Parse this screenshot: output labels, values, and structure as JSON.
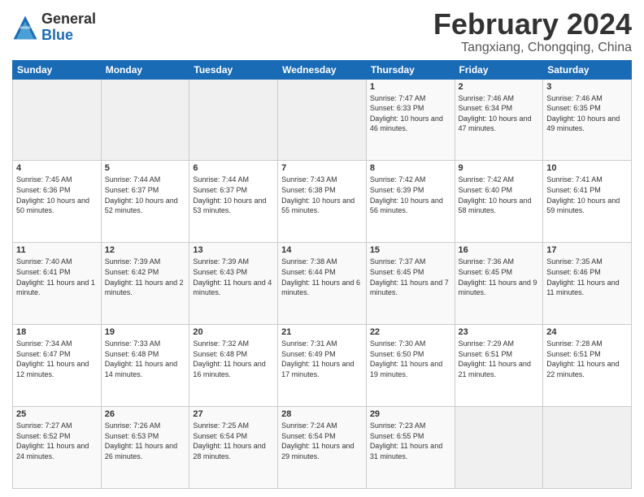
{
  "logo": {
    "general": "General",
    "blue": "Blue"
  },
  "title": {
    "month_year": "February 2024",
    "location": "Tangxiang, Chongqing, China"
  },
  "weekdays": [
    "Sunday",
    "Monday",
    "Tuesday",
    "Wednesday",
    "Thursday",
    "Friday",
    "Saturday"
  ],
  "weeks": [
    [
      {
        "day": "",
        "sunrise": "",
        "sunset": "",
        "daylight": ""
      },
      {
        "day": "",
        "sunrise": "",
        "sunset": "",
        "daylight": ""
      },
      {
        "day": "",
        "sunrise": "",
        "sunset": "",
        "daylight": ""
      },
      {
        "day": "",
        "sunrise": "",
        "sunset": "",
        "daylight": ""
      },
      {
        "day": "1",
        "sunrise": "Sunrise: 7:47 AM",
        "sunset": "Sunset: 6:33 PM",
        "daylight": "Daylight: 10 hours and 46 minutes."
      },
      {
        "day": "2",
        "sunrise": "Sunrise: 7:46 AM",
        "sunset": "Sunset: 6:34 PM",
        "daylight": "Daylight: 10 hours and 47 minutes."
      },
      {
        "day": "3",
        "sunrise": "Sunrise: 7:46 AM",
        "sunset": "Sunset: 6:35 PM",
        "daylight": "Daylight: 10 hours and 49 minutes."
      }
    ],
    [
      {
        "day": "4",
        "sunrise": "Sunrise: 7:45 AM",
        "sunset": "Sunset: 6:36 PM",
        "daylight": "Daylight: 10 hours and 50 minutes."
      },
      {
        "day": "5",
        "sunrise": "Sunrise: 7:44 AM",
        "sunset": "Sunset: 6:37 PM",
        "daylight": "Daylight: 10 hours and 52 minutes."
      },
      {
        "day": "6",
        "sunrise": "Sunrise: 7:44 AM",
        "sunset": "Sunset: 6:37 PM",
        "daylight": "Daylight: 10 hours and 53 minutes."
      },
      {
        "day": "7",
        "sunrise": "Sunrise: 7:43 AM",
        "sunset": "Sunset: 6:38 PM",
        "daylight": "Daylight: 10 hours and 55 minutes."
      },
      {
        "day": "8",
        "sunrise": "Sunrise: 7:42 AM",
        "sunset": "Sunset: 6:39 PM",
        "daylight": "Daylight: 10 hours and 56 minutes."
      },
      {
        "day": "9",
        "sunrise": "Sunrise: 7:42 AM",
        "sunset": "Sunset: 6:40 PM",
        "daylight": "Daylight: 10 hours and 58 minutes."
      },
      {
        "day": "10",
        "sunrise": "Sunrise: 7:41 AM",
        "sunset": "Sunset: 6:41 PM",
        "daylight": "Daylight: 10 hours and 59 minutes."
      }
    ],
    [
      {
        "day": "11",
        "sunrise": "Sunrise: 7:40 AM",
        "sunset": "Sunset: 6:41 PM",
        "daylight": "Daylight: 11 hours and 1 minute."
      },
      {
        "day": "12",
        "sunrise": "Sunrise: 7:39 AM",
        "sunset": "Sunset: 6:42 PM",
        "daylight": "Daylight: 11 hours and 2 minutes."
      },
      {
        "day": "13",
        "sunrise": "Sunrise: 7:39 AM",
        "sunset": "Sunset: 6:43 PM",
        "daylight": "Daylight: 11 hours and 4 minutes."
      },
      {
        "day": "14",
        "sunrise": "Sunrise: 7:38 AM",
        "sunset": "Sunset: 6:44 PM",
        "daylight": "Daylight: 11 hours and 6 minutes."
      },
      {
        "day": "15",
        "sunrise": "Sunrise: 7:37 AM",
        "sunset": "Sunset: 6:45 PM",
        "daylight": "Daylight: 11 hours and 7 minutes."
      },
      {
        "day": "16",
        "sunrise": "Sunrise: 7:36 AM",
        "sunset": "Sunset: 6:45 PM",
        "daylight": "Daylight: 11 hours and 9 minutes."
      },
      {
        "day": "17",
        "sunrise": "Sunrise: 7:35 AM",
        "sunset": "Sunset: 6:46 PM",
        "daylight": "Daylight: 11 hours and 11 minutes."
      }
    ],
    [
      {
        "day": "18",
        "sunrise": "Sunrise: 7:34 AM",
        "sunset": "Sunset: 6:47 PM",
        "daylight": "Daylight: 11 hours and 12 minutes."
      },
      {
        "day": "19",
        "sunrise": "Sunrise: 7:33 AM",
        "sunset": "Sunset: 6:48 PM",
        "daylight": "Daylight: 11 hours and 14 minutes."
      },
      {
        "day": "20",
        "sunrise": "Sunrise: 7:32 AM",
        "sunset": "Sunset: 6:48 PM",
        "daylight": "Daylight: 11 hours and 16 minutes."
      },
      {
        "day": "21",
        "sunrise": "Sunrise: 7:31 AM",
        "sunset": "Sunset: 6:49 PM",
        "daylight": "Daylight: 11 hours and 17 minutes."
      },
      {
        "day": "22",
        "sunrise": "Sunrise: 7:30 AM",
        "sunset": "Sunset: 6:50 PM",
        "daylight": "Daylight: 11 hours and 19 minutes."
      },
      {
        "day": "23",
        "sunrise": "Sunrise: 7:29 AM",
        "sunset": "Sunset: 6:51 PM",
        "daylight": "Daylight: 11 hours and 21 minutes."
      },
      {
        "day": "24",
        "sunrise": "Sunrise: 7:28 AM",
        "sunset": "Sunset: 6:51 PM",
        "daylight": "Daylight: 11 hours and 22 minutes."
      }
    ],
    [
      {
        "day": "25",
        "sunrise": "Sunrise: 7:27 AM",
        "sunset": "Sunset: 6:52 PM",
        "daylight": "Daylight: 11 hours and 24 minutes."
      },
      {
        "day": "26",
        "sunrise": "Sunrise: 7:26 AM",
        "sunset": "Sunset: 6:53 PM",
        "daylight": "Daylight: 11 hours and 26 minutes."
      },
      {
        "day": "27",
        "sunrise": "Sunrise: 7:25 AM",
        "sunset": "Sunset: 6:54 PM",
        "daylight": "Daylight: 11 hours and 28 minutes."
      },
      {
        "day": "28",
        "sunrise": "Sunrise: 7:24 AM",
        "sunset": "Sunset: 6:54 PM",
        "daylight": "Daylight: 11 hours and 29 minutes."
      },
      {
        "day": "29",
        "sunrise": "Sunrise: 7:23 AM",
        "sunset": "Sunset: 6:55 PM",
        "daylight": "Daylight: 11 hours and 31 minutes."
      },
      {
        "day": "",
        "sunrise": "",
        "sunset": "",
        "daylight": ""
      },
      {
        "day": "",
        "sunrise": "",
        "sunset": "",
        "daylight": ""
      }
    ]
  ]
}
